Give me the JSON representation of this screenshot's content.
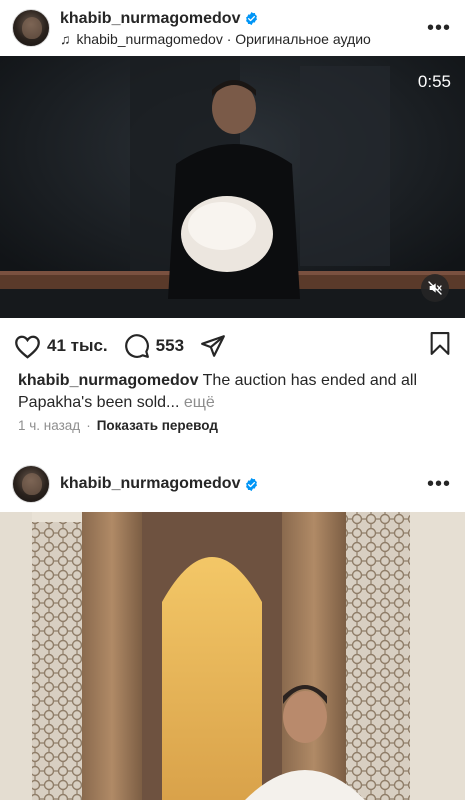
{
  "posts": [
    {
      "username": "khabib_nurmagomedov",
      "audio": "khabib_nurmagomedov · Оригинальное аудио",
      "video_time": "0:55",
      "likes": "41 тыс.",
      "comments": "553",
      "caption_user": "khabib_nurmagomedov",
      "caption_text": " The auction has ended and all Papakha's been sold...",
      "caption_more": " ещё",
      "time_ago": "1 ч. назад",
      "translate": "Показать перевод"
    },
    {
      "username": "khabib_nurmagomedov"
    }
  ],
  "icons": {
    "audio": "music-note-icon",
    "verified": "verified-badge-icon",
    "more": "more-options-icon",
    "mute": "muted-speaker-icon",
    "like": "heart-icon",
    "comment": "comment-bubble-icon",
    "share": "paper-plane-icon",
    "save": "bookmark-icon"
  },
  "colors": {
    "verified": "#0095f6",
    "text": "#262626",
    "secondary": "#8e8e8e"
  }
}
